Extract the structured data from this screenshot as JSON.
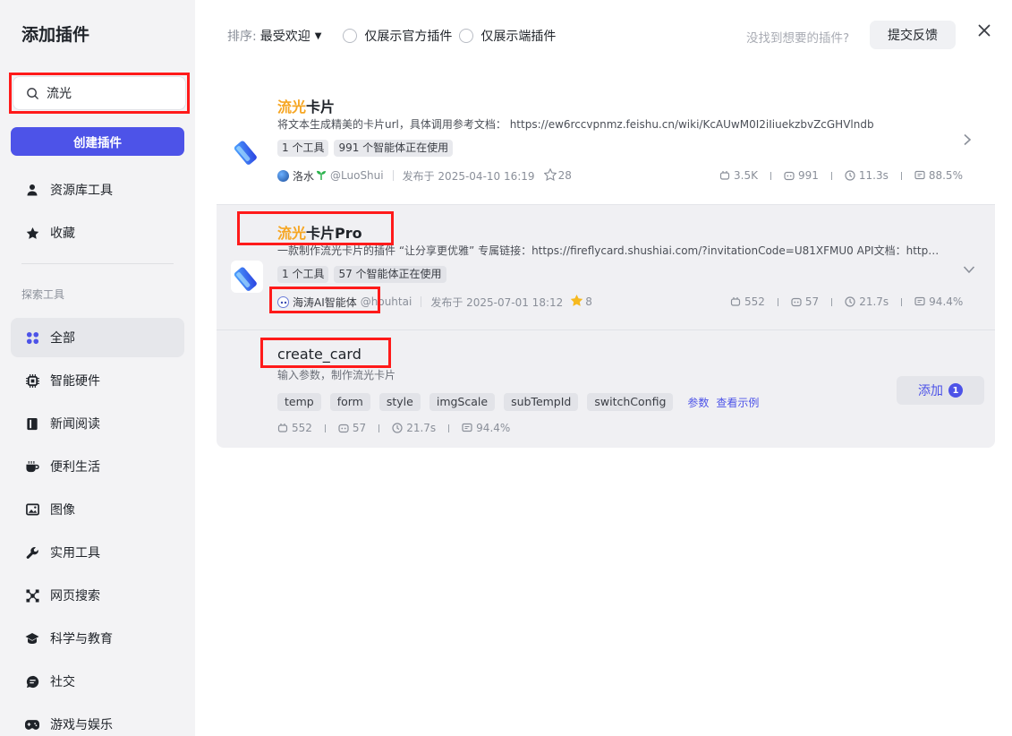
{
  "sidebar": {
    "title": "添加插件",
    "search_value": "流光",
    "create_label": "创建插件",
    "top_items": [
      {
        "label": "资源库工具",
        "icon": "user-icon"
      },
      {
        "label": "收藏",
        "icon": "star-icon"
      }
    ],
    "section_label": "探索工具",
    "categories": [
      {
        "label": "全部",
        "icon": "grid-icon",
        "active": true
      },
      {
        "label": "智能硬件",
        "icon": "chip-icon"
      },
      {
        "label": "新闻阅读",
        "icon": "book-icon"
      },
      {
        "label": "便利生活",
        "icon": "cup-icon"
      },
      {
        "label": "图像",
        "icon": "image-icon"
      },
      {
        "label": "实用工具",
        "icon": "wrench-icon"
      },
      {
        "label": "网页搜索",
        "icon": "network-icon"
      },
      {
        "label": "科学与教育",
        "icon": "graduation-cap-icon"
      },
      {
        "label": "社交",
        "icon": "chat-icon"
      },
      {
        "label": "游戏与娱乐",
        "icon": "gamepad-icon"
      }
    ]
  },
  "topbar": {
    "sort_label": "排序:",
    "sort_value": "最受欢迎",
    "filter_official": "仅展示官方插件",
    "filter_client": "仅展示端插件",
    "hint": "没找到想要的插件?",
    "feedback": "提交反馈"
  },
  "plugins": [
    {
      "title_hl": "流光",
      "title_rest": "卡片",
      "desc": "将文本生成精美的卡片url，具体调用参考文档： https://ew6rccvpnmz.feishu.cn/wiki/KcAUwM0I2iIiuekzbvZcGHVlndb",
      "tools": "1 个工具",
      "agents": "991 个智能体正在使用",
      "author": "洛水",
      "handle": "@LuoShui",
      "published": "发布于 2025-04-10 16:19",
      "favorites": "28",
      "stats": [
        "3.5K",
        "991",
        "11.3s",
        "88.5%"
      ]
    },
    {
      "title_hl": "流光",
      "title_rest": "卡片Pro",
      "desc": "一款制作流光卡片的插件 “让分享更优雅” 专属链接：https://fireflycard.shushiai.com/?invitationCode=U81XFMU0 API文档：https://fireflycard.shushiai.com/docs",
      "tools": "1 个工具",
      "agents": "57 个智能体正在使用",
      "author": "海涛AI智能体",
      "handle": "@houhtai",
      "published": "发布于 2025-07-01 18:12",
      "favorites": "8",
      "stats": [
        "552",
        "57",
        "21.7s",
        "94.4%"
      ]
    }
  ],
  "tool": {
    "name": "create_card",
    "desc": "输入参数，制作流光卡片",
    "params": [
      "temp",
      "form",
      "style",
      "imgScale",
      "subTempId",
      "switchConfig"
    ],
    "params_link": "参数",
    "example_link": "查看示例",
    "stats": [
      "552",
      "57",
      "21.7s",
      "94.4%"
    ],
    "add_label": "添加",
    "add_badge": "1"
  },
  "colors": {
    "accent": "#4d53e8",
    "highlight": "#f6a623",
    "annotation": "#ff1a1a"
  }
}
